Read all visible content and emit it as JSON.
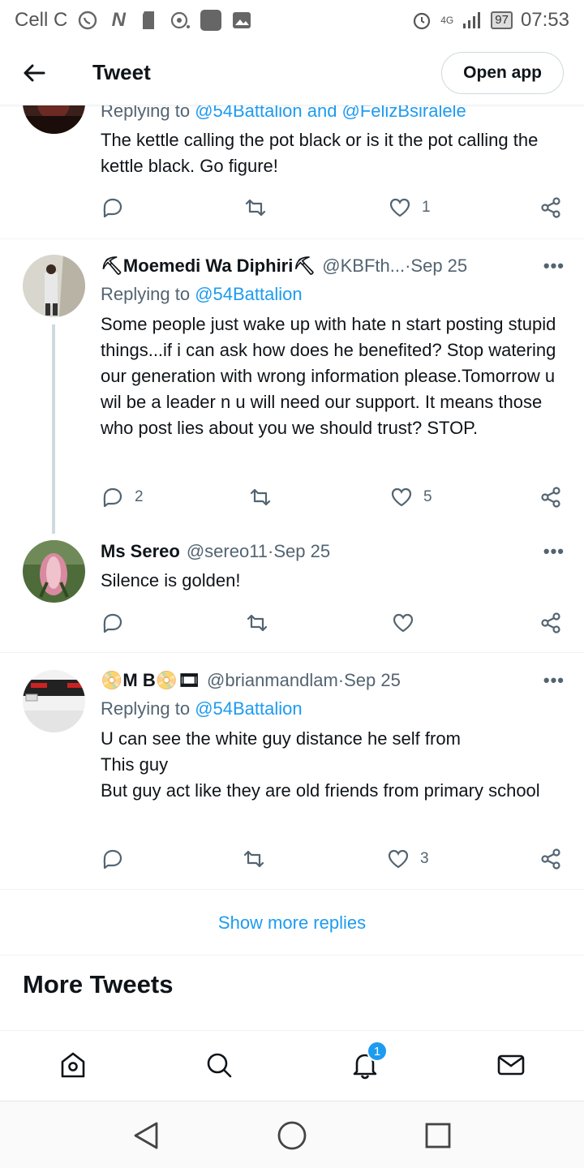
{
  "status_bar": {
    "carrier": "Cell C",
    "network": "4G",
    "battery": "97",
    "time": "07:53"
  },
  "header": {
    "title": "Tweet",
    "open_app": "Open app"
  },
  "tweets": [
    {
      "reply_to_prefix": "Replying to ",
      "reply_to_users": "@54Battalion and @FelizBsiralele",
      "text": "The kettle calling the pot black or is it the pot calling the kettle black. Go figure!",
      "replies": "",
      "retweets": "",
      "likes": "1"
    },
    {
      "name": "⛏Moemedi Wa Diphiri⛏",
      "handle": "@KBFth...",
      "sep": " · ",
      "date": "Sep 25",
      "reply_to_prefix": "Replying to ",
      "reply_to_users": "@54Battalion",
      "text": "Some people just wake up with hate n start posting stupid things...if i can ask how does he benefited? Stop watering our generation with wrong information please.Tomorrow u wil be a leader n u will need our support. It means those who post lies about you we should trust? STOP.",
      "replies": "2",
      "retweets": "",
      "likes": "5"
    },
    {
      "name": "Ms Sereo",
      "handle": "@sereo11",
      "sep": " · ",
      "date": "Sep 25",
      "text": "Silence is golden!",
      "replies": "",
      "retweets": "",
      "likes": ""
    },
    {
      "name": "📀M B📀🎞",
      "handle": "@brianmandlam",
      "sep": " · ",
      "date": "Sep 25",
      "reply_to_prefix": "Replying to ",
      "reply_to_users": "@54Battalion",
      "text": "U can see the white guy distance he self from\nThis guy\nBut guy act like they are old friends from primary school",
      "replies": "",
      "retweets": "",
      "likes": "3"
    }
  ],
  "show_more": "Show more replies",
  "more_tweets": "More Tweets",
  "tabbar": {
    "notifications_badge": "1"
  },
  "colors": {
    "accent": "#1d9bf0",
    "text": "#0f1419",
    "secondary": "#536471"
  }
}
